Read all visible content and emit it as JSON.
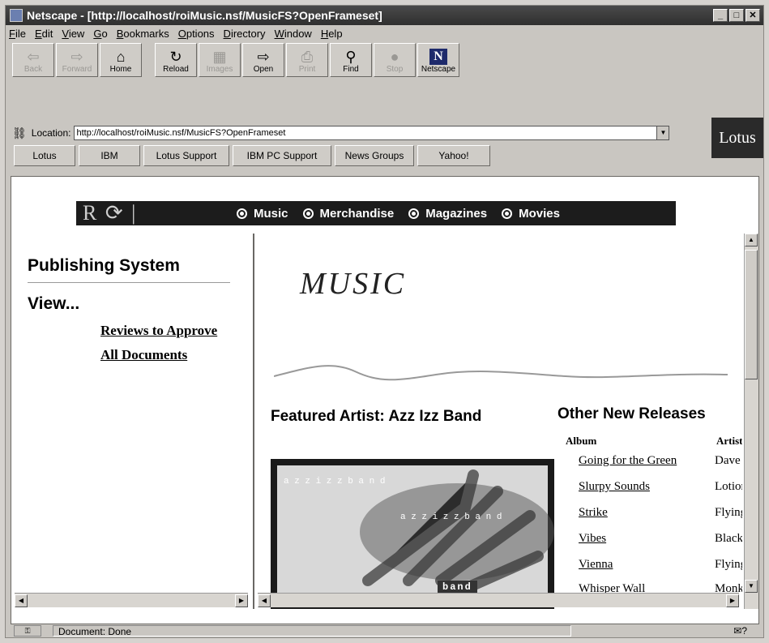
{
  "window": {
    "title": "Netscape - [http://localhost/roiMusic.nsf/MusicFS?OpenFrameset]"
  },
  "menu": [
    "File",
    "Edit",
    "View",
    "Go",
    "Bookmarks",
    "Options",
    "Directory",
    "Window",
    "Help"
  ],
  "toolbar": {
    "back": "Back",
    "forward": "Forward",
    "home": "Home",
    "reload": "Reload",
    "images": "Images",
    "open": "Open",
    "print": "Print",
    "find": "Find",
    "stop": "Stop",
    "netscape": "Netscape"
  },
  "location": {
    "label": "Location:",
    "url": "http://localhost/roiMusic.nsf/MusicFS?OpenFrameset"
  },
  "brand": "Lotus",
  "directory_buttons": [
    "Lotus",
    "IBM",
    "Lotus Support",
    "IBM PC Support",
    "News Groups",
    "Yahoo!"
  ],
  "banner": {
    "logo": "R",
    "nav": [
      "Music",
      "Merchandise",
      "Magazines",
      "Movies"
    ]
  },
  "left": {
    "title": "Publishing System",
    "view_label": "View...",
    "links": [
      "Reviews to Approve",
      "All Documents"
    ]
  },
  "right": {
    "heading_script": "MUSIC",
    "featured_heading": "Featured Artist: Azz Izz Band",
    "featured_image_text_top": "a z z   i z z   b a n d",
    "featured_image_text_mid": "a z z   i z z   b a n d",
    "featured_image_band": "band",
    "other_heading": "Other New Releases",
    "columns": {
      "album": "Album",
      "artist": "Artist"
    },
    "releases": [
      {
        "album": "Going for the Green",
        "artist": "Dave I"
      },
      {
        "album": "Slurpy Sounds",
        "artist": "Lotion"
      },
      {
        "album": "Strike",
        "artist": "Flying"
      },
      {
        "album": "Vibes",
        "artist": "Black"
      },
      {
        "album": "Vienna",
        "artist": "Flying"
      },
      {
        "album": "Whisper Wall",
        "artist": "Monk"
      }
    ]
  },
  "status": {
    "text": "Document: Done"
  }
}
